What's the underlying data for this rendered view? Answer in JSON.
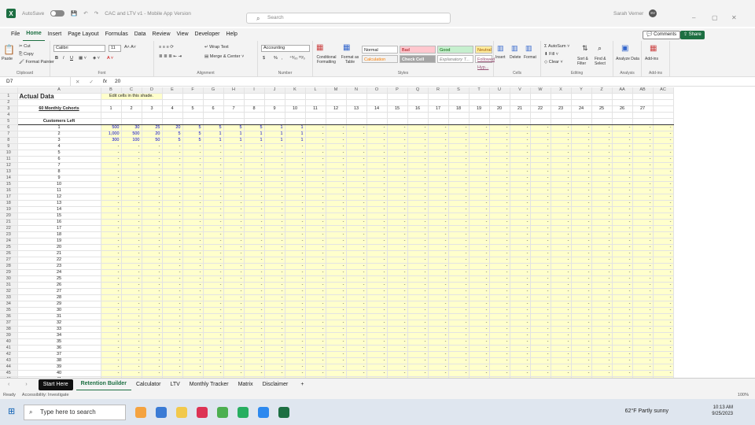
{
  "titlebar": {
    "autosave": "AutoSave",
    "autosave_state": "Off",
    "filename": "CAC and LTV v1 - Mobile App Version",
    "search_placeholder": "Search",
    "user": "Sarah Verner",
    "user_initials": "SV",
    "min": "–",
    "max": "▢",
    "close": "✕"
  },
  "menu": [
    "File",
    "Home",
    "Insert",
    "Page Layout",
    "Formulas",
    "Data",
    "Review",
    "View",
    "Developer",
    "Help"
  ],
  "menu_active": "Home",
  "comments": "Comments",
  "share": "Share",
  "ribbon": {
    "clipboard": {
      "paste": "Paste",
      "cut": "Cut",
      "copy": "Copy",
      "format_painter": "Format Painter",
      "label": "Clipboard"
    },
    "font": {
      "name": "Calibri",
      "size": "11",
      "bold": "B",
      "italic": "I",
      "underline": "U",
      "label": "Font"
    },
    "alignment": {
      "wrap": "Wrap Text",
      "merge": "Merge & Center",
      "label": "Alignment"
    },
    "number": {
      "format": "Accounting",
      "currency": "$",
      "percent": "%",
      "comma": ",",
      "label": "Number"
    },
    "styles": {
      "conditional": "Conditional Formatting",
      "format_table": "Format as Table",
      "normal": "Normal",
      "bad": "Bad",
      "good": "Good",
      "neutral": "Neutral",
      "calculation": "Calculation",
      "check": "Check Cell",
      "explanatory": "Explanatory T...",
      "followed": "Followed Hyp...",
      "label": "Styles"
    },
    "cells": {
      "insert": "Insert",
      "delete": "Delete",
      "format": "Format",
      "label": "Cells"
    },
    "editing": {
      "autosum": "AutoSum",
      "fill": "Fill",
      "clear": "Clear",
      "sort": "Sort & Filter",
      "find": "Find & Select",
      "label": "Editing"
    },
    "analysis": {
      "analyze": "Analyze Data",
      "label": "Analysis"
    },
    "addins": {
      "addins": "Add-ins",
      "label": "Add-ins"
    }
  },
  "formula": {
    "cell": "D7",
    "fx": "fx",
    "value": "20"
  },
  "sheet": {
    "columns": [
      "A",
      "B",
      "C",
      "D",
      "E",
      "F",
      "G",
      "H",
      "I",
      "J",
      "K",
      "L",
      "M",
      "N",
      "O",
      "P",
      "Q",
      "R",
      "S",
      "T",
      "U",
      "V",
      "W",
      "X",
      "Y",
      "Z",
      "AA",
      "AB",
      "AC"
    ],
    "title": "Actual Data",
    "note": "Edit cells in this shade.",
    "cohorts_label": "60 Monthly Cohorts",
    "cohort_numbers": [
      "1",
      "2",
      "3",
      "4",
      "5",
      "6",
      "7",
      "8",
      "9",
      "10",
      "11",
      "12",
      "13",
      "14",
      "15",
      "16",
      "17",
      "18",
      "19",
      "20",
      "21",
      "22",
      "23",
      "24",
      "25",
      "26",
      "27"
    ],
    "customers_left": "Customers Left",
    "row1": [
      "500",
      "30",
      "25",
      "20",
      "5",
      "5",
      "5",
      "5",
      "1",
      "1"
    ],
    "row2": [
      "1,000",
      "500",
      "20",
      "5",
      "5",
      "1",
      "1",
      "1",
      "1",
      "1"
    ],
    "row3": [
      "300",
      "100",
      "50",
      "5",
      "5",
      "1",
      "1",
      "1",
      "1",
      "1"
    ],
    "dash": "-"
  },
  "tabs": [
    "Start Here",
    "Retention Builder",
    "Calculator",
    "LTV",
    "Monthly Tracker",
    "Matrix",
    "Disclaimer"
  ],
  "tab_active": "Retention Builder",
  "status": {
    "ready": "Ready",
    "accessibility": "Accessibility: Investigate",
    "zoom": "100%"
  },
  "taskbar": {
    "search": "Type here to search",
    "weather": "62°F Partly sunny",
    "time": "10:13 AM",
    "date": "9/25/2023"
  }
}
